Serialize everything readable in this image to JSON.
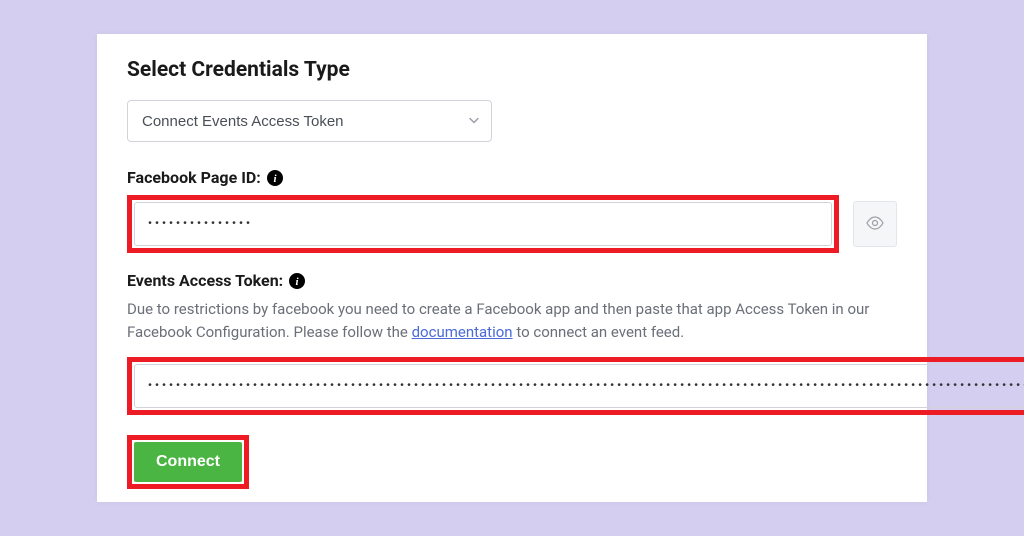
{
  "title": "Select Credentials Type",
  "select": {
    "value": "Connect Events Access Token"
  },
  "fields": {
    "pageId": {
      "label": "Facebook Page ID:",
      "masked": "•••••••••••••••"
    },
    "accessToken": {
      "label": "Events Access Token:",
      "helpPrefix": "Due to restrictions by facebook you need to create a Facebook app and then paste that app Access Token in our Facebook Configuration. Please follow the ",
      "linkText": "documentation",
      "helpSuffix": " to connect an event feed.",
      "masked": "••••••••••••••••••••••••••••••••••••••••••••••••••••••••••••••••••••••••••••••••••••••••••••••••••••••••••••••••••••••••••••••••••••••••••••"
    }
  },
  "connectLabel": "Connect"
}
